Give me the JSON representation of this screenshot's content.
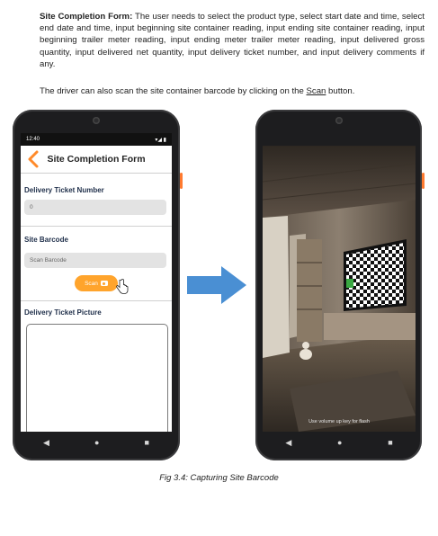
{
  "intro": {
    "heading": "Site Completion Form:",
    "text": " The user needs to select the product type, select start date and time, select end date and time, input beginning site container reading, input ending site container reading, input beginning trailer meter reading, input ending meter trailer meter reading, input delivered gross quantity, input delivered net quantity, input delivery ticket number, and input delivery comments if any."
  },
  "scan_note": {
    "before": "The driver can also scan the site container barcode by clicking on the ",
    "link": "Scan",
    "after": " button."
  },
  "phone1": {
    "status": {
      "time": "12:40",
      "icons": "▾◢ ▮"
    },
    "title": "Site Completion Form",
    "ticket_label": "Delivery Ticket Number",
    "ticket_value": "0",
    "barcode_label": "Site Barcode",
    "barcode_placeholder": "Scan Barcode",
    "scan_button": "Scan",
    "picture_label": "Delivery Ticket Picture",
    "nav": [
      "◀",
      "●",
      "■"
    ]
  },
  "phone2": {
    "hint": "Use volume up key for flash",
    "nav": [
      "◀",
      "●",
      "■"
    ]
  },
  "caption": "Fig 3.4: Capturing Site Barcode",
  "colors": {
    "accent_orange": "#FFA42C",
    "arrow_blue": "#4A8FD3",
    "phone_body": "#1D1D1F"
  }
}
